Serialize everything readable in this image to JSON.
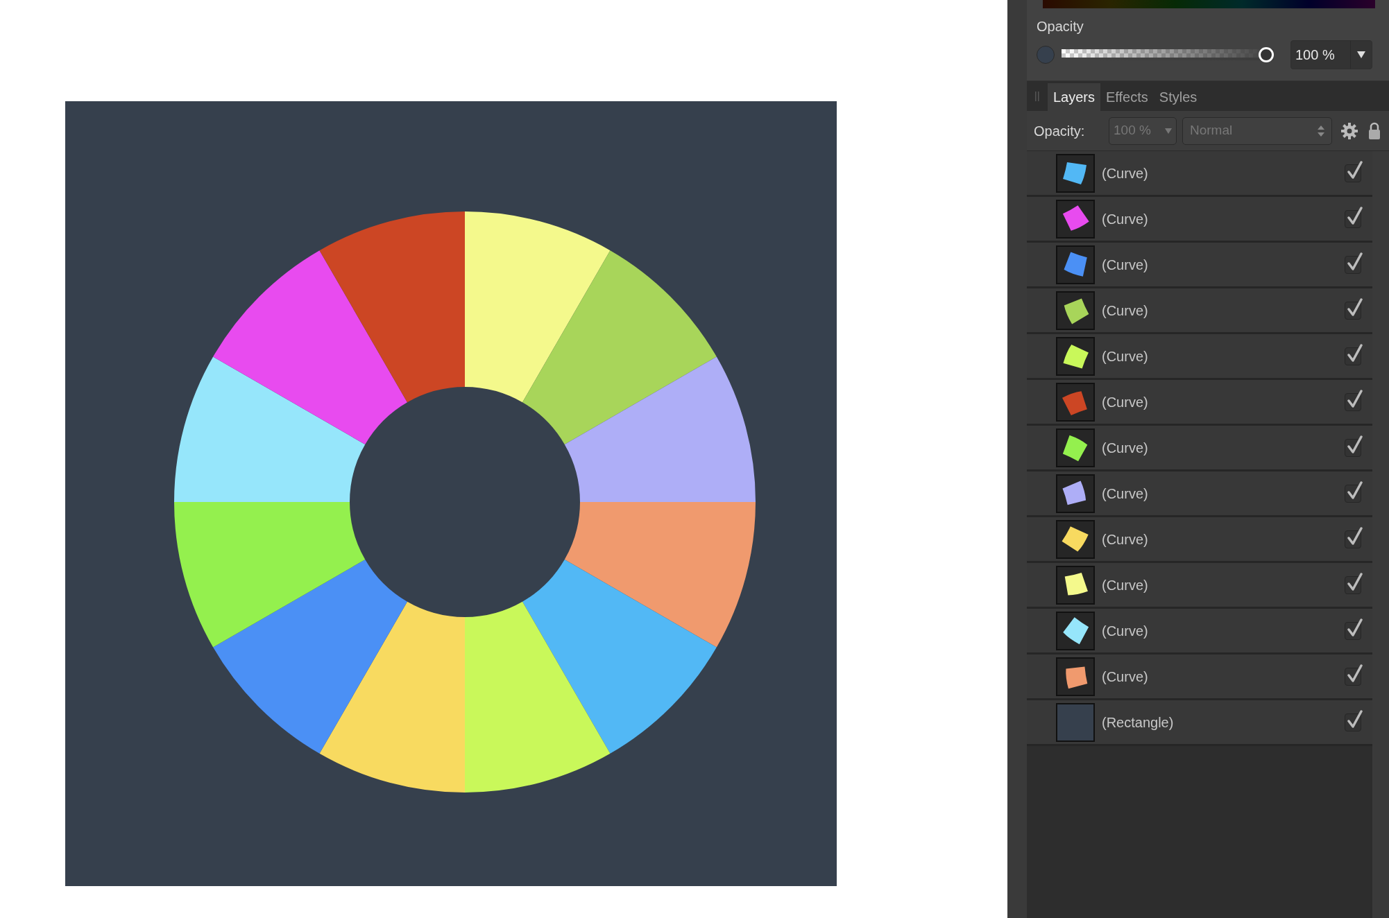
{
  "artwork": {
    "segments": [
      {
        "color": "#f4f98c"
      },
      {
        "color": "#a8d55a"
      },
      {
        "color": "#aeaef7"
      },
      {
        "color": "#f09a6e"
      },
      {
        "color": "#52b8f5"
      },
      {
        "color": "#c9f85a"
      },
      {
        "color": "#f8da60"
      },
      {
        "color": "#4b90f5"
      },
      {
        "color": "#94f04e"
      },
      {
        "color": "#96e6fb"
      },
      {
        "color": "#e84bef"
      },
      {
        "color": "#cc4624"
      }
    ]
  },
  "color_panel": {
    "opacity_label": "Opacity",
    "opacity": {
      "level": 1,
      "value": "100 %"
    }
  },
  "tabs": [
    {
      "label": "Layers",
      "selected": true
    },
    {
      "label": "Effects",
      "selected": false
    },
    {
      "label": "Styles",
      "selected": false
    }
  ],
  "layers_toolbar": {
    "opacity_label": "Opacity:",
    "opacity_value": "100 %",
    "blend_mode": "Normal"
  },
  "layers": [
    {
      "name": "(Curve)",
      "kind": "curve",
      "color": "#52b8f5",
      "visible": true
    },
    {
      "name": "(Curve)",
      "kind": "curve",
      "color": "#e84bef",
      "visible": true
    },
    {
      "name": "(Curve)",
      "kind": "curve",
      "color": "#4b90f5",
      "visible": true
    },
    {
      "name": "(Curve)",
      "kind": "curve",
      "color": "#a8d55a",
      "visible": true
    },
    {
      "name": "(Curve)",
      "kind": "curve",
      "color": "#c9f85a",
      "visible": true
    },
    {
      "name": "(Curve)",
      "kind": "curve",
      "color": "#cc4624",
      "visible": true
    },
    {
      "name": "(Curve)",
      "kind": "curve",
      "color": "#94f04e",
      "visible": true
    },
    {
      "name": "(Curve)",
      "kind": "curve",
      "color": "#aeaef7",
      "visible": true
    },
    {
      "name": "(Curve)",
      "kind": "curve",
      "color": "#f8da60",
      "visible": true
    },
    {
      "name": "(Curve)",
      "kind": "curve",
      "color": "#f4f98c",
      "visible": true
    },
    {
      "name": "(Curve)",
      "kind": "curve",
      "color": "#96e6fb",
      "visible": true
    },
    {
      "name": "(Curve)",
      "kind": "curve",
      "color": "#f09a6e",
      "visible": true
    },
    {
      "name": "(Rectangle)",
      "kind": "rectangle",
      "color": "#36404d",
      "visible": true
    }
  ]
}
